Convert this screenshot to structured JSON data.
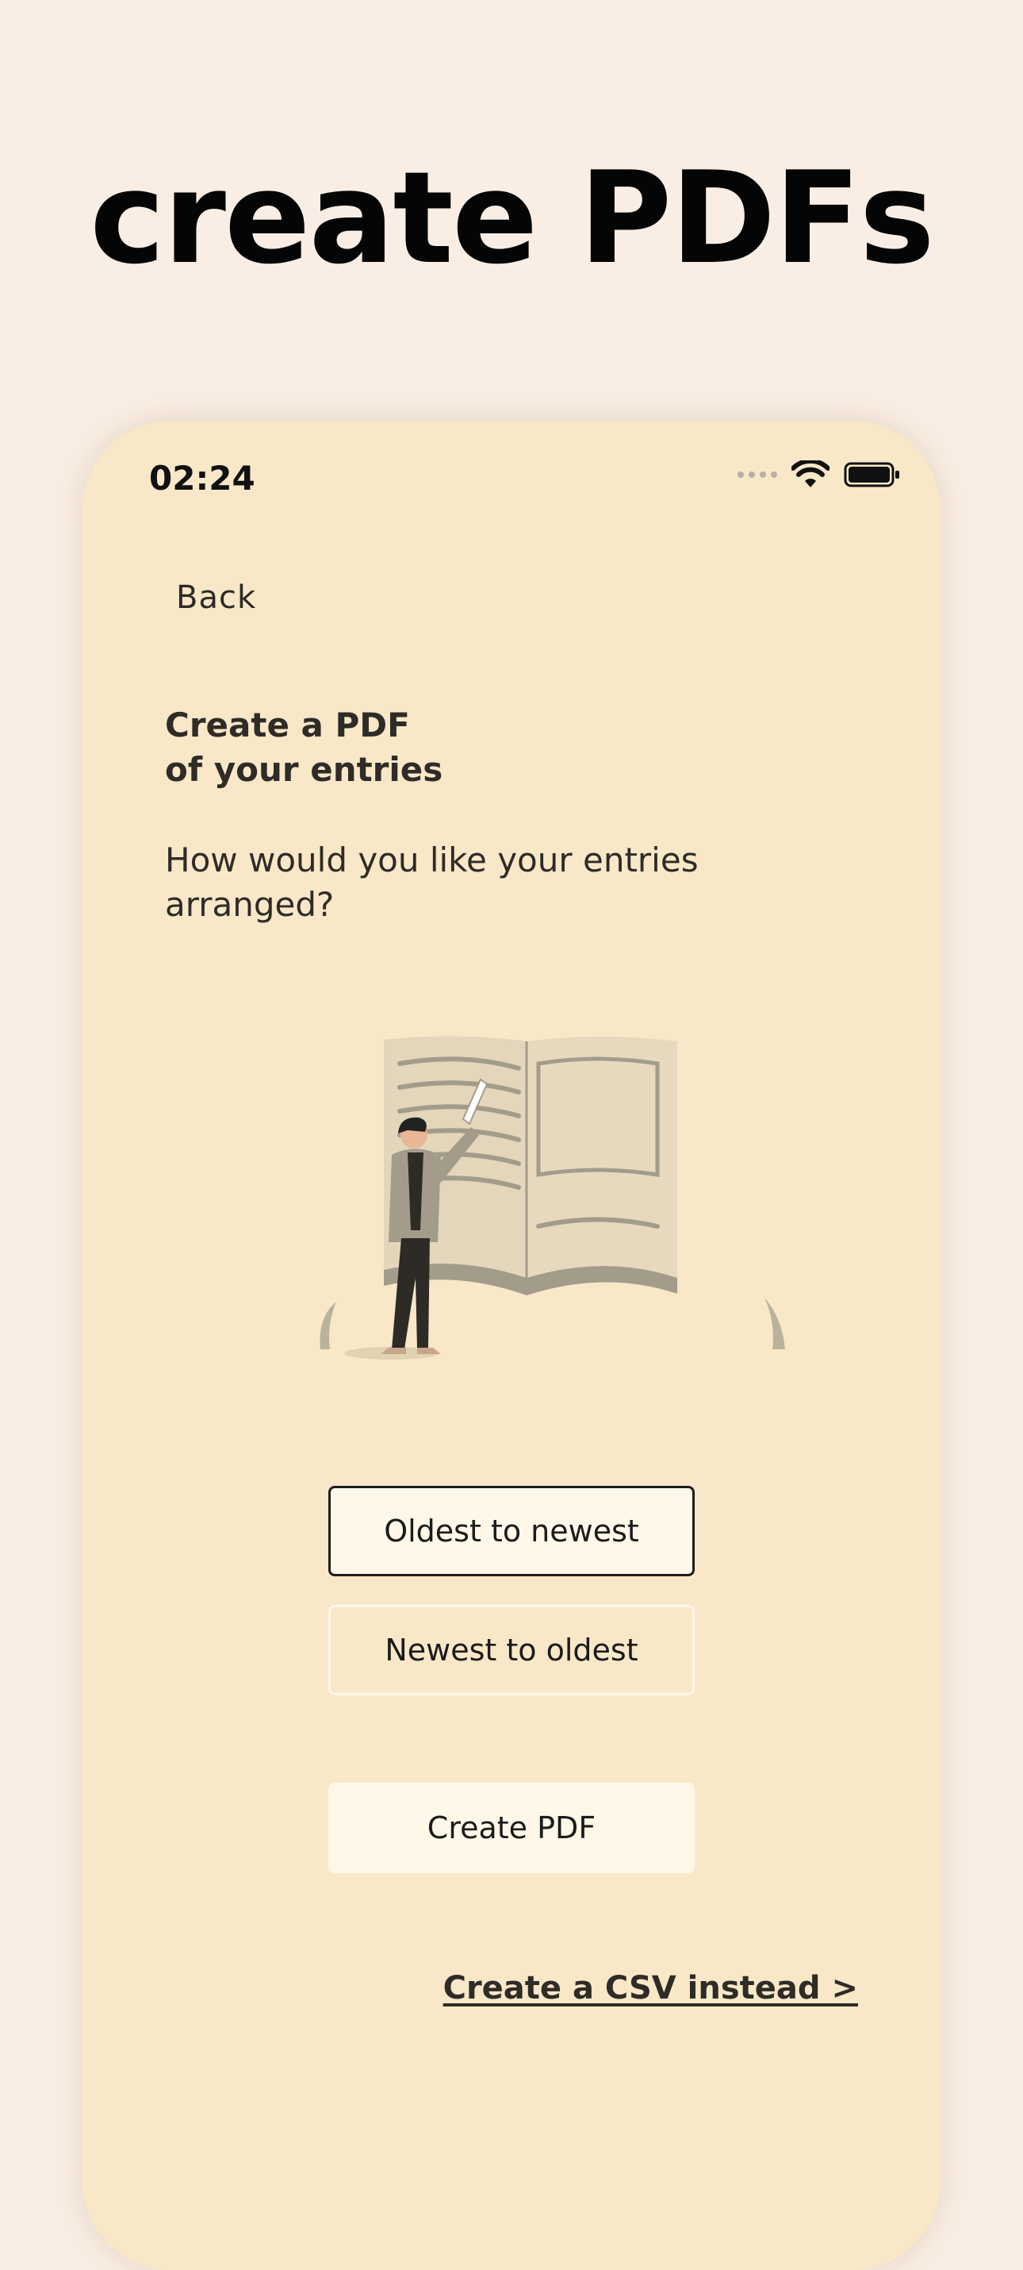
{
  "headline": "create PDFs",
  "status_bar": {
    "time": "02:24",
    "icons": [
      "signal-dots-icon",
      "wifi-icon",
      "battery-icon"
    ]
  },
  "nav": {
    "back_label": "Back"
  },
  "content": {
    "title": "Create a PDF\nof your entries",
    "subtitle": "How would you like your entries arranged?"
  },
  "sort_options": {
    "oldest_label": "Oldest to newest",
    "newest_label": "Newest to oldest",
    "selected": "oldest"
  },
  "actions": {
    "create_pdf_label": "Create PDF",
    "csv_link_label": "Create a CSV instead >"
  },
  "colors": {
    "page_background": "#faeee4",
    "screen_background": "#f9e8c8",
    "button_fill": "#fff7e8",
    "text": "#2f2b27"
  }
}
